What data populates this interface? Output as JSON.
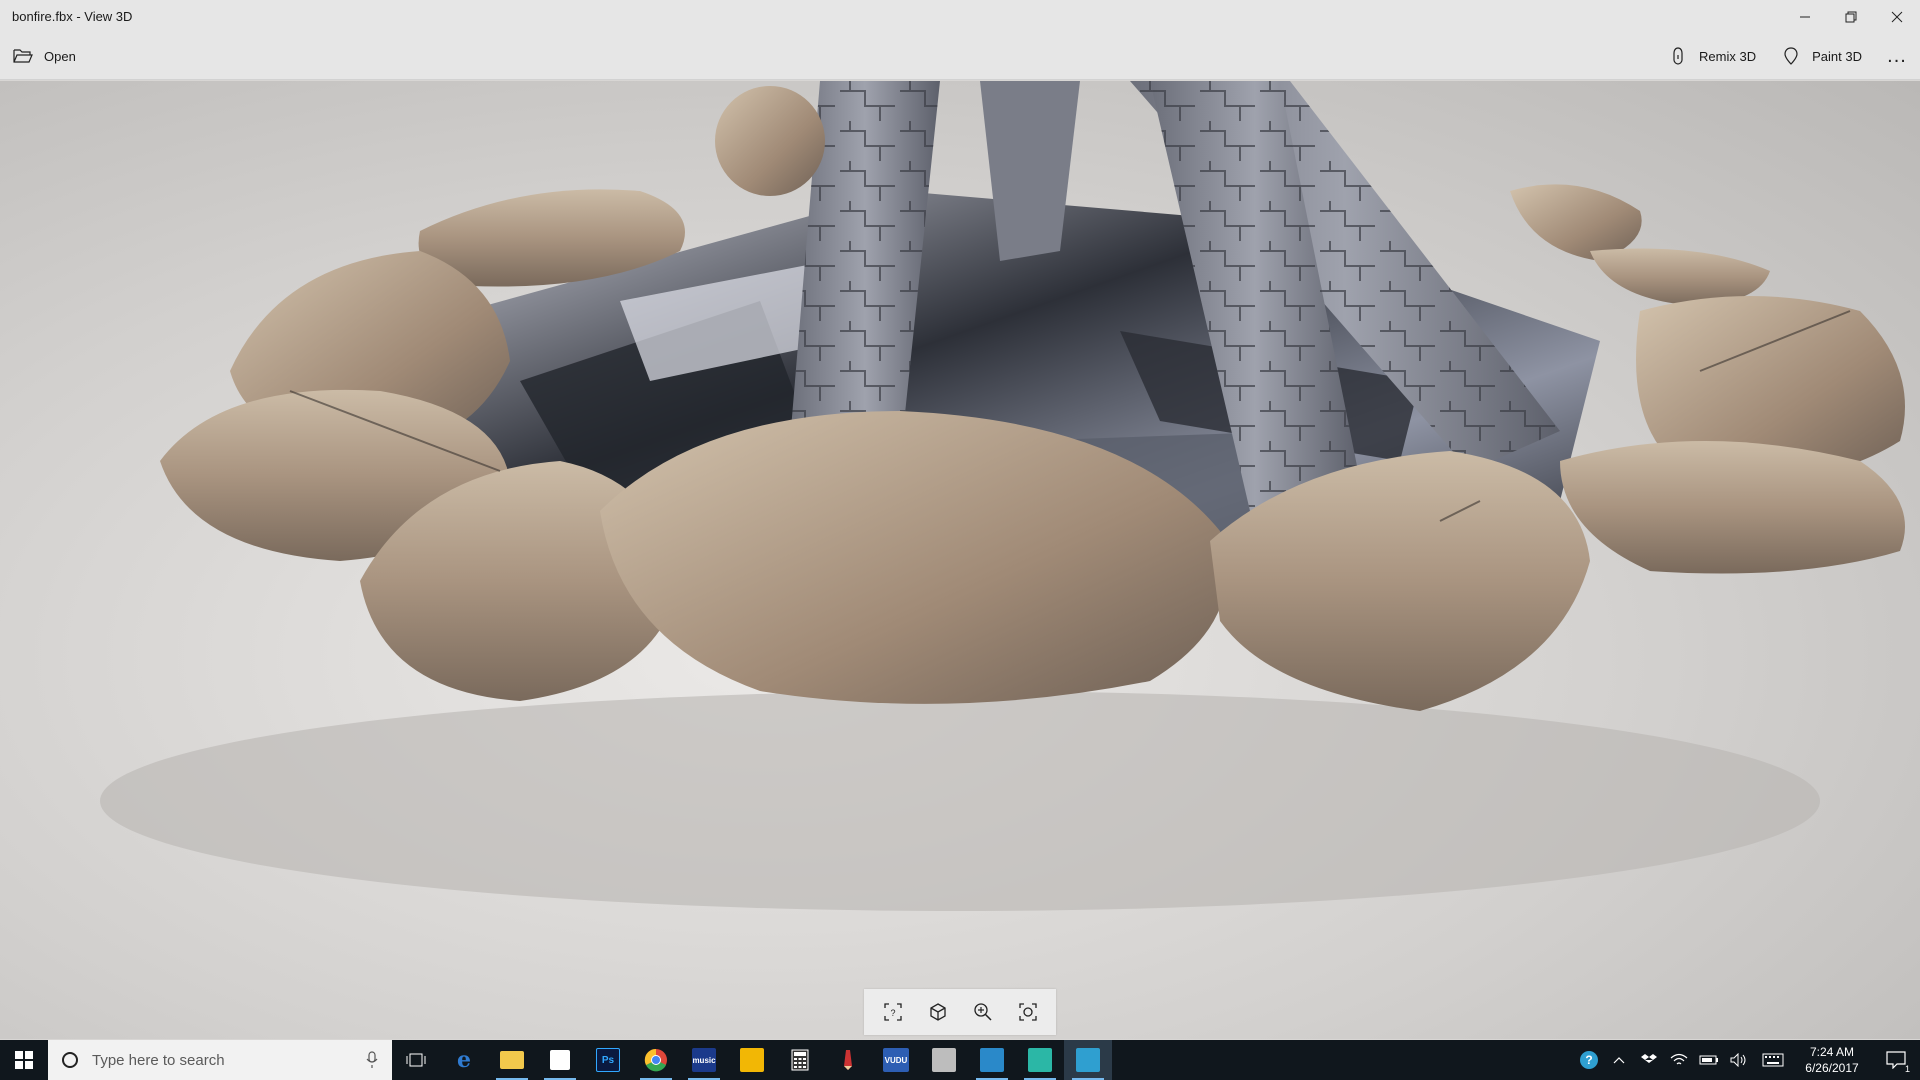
{
  "window": {
    "title": "bonfire.fbx - View 3D"
  },
  "commandbar": {
    "open_label": "Open",
    "remix_label": "Remix 3D",
    "paint_label": "Paint 3D",
    "more_label": "..."
  },
  "viewport": {
    "model": "bonfire",
    "toolbar": [
      "fit-to-view-icon",
      "3d-cube-icon",
      "zoom-icon",
      "capture-icon"
    ]
  },
  "taskbar": {
    "search_placeholder": "Type here to search",
    "apps": [
      {
        "name": "task-view",
        "label": ""
      },
      {
        "name": "edge",
        "label": "e",
        "color": "#2f7bd1"
      },
      {
        "name": "file-explorer",
        "label": "",
        "color": "#f2c94c"
      },
      {
        "name": "store",
        "label": "",
        "color": "#ffffff"
      },
      {
        "name": "photoshop",
        "label": "Ps",
        "color": "#0a1a40"
      },
      {
        "name": "chrome",
        "label": "",
        "color": "#e0473a"
      },
      {
        "name": "amazon-music",
        "label": "music",
        "color": "#1b3a8b"
      },
      {
        "name": "sticky",
        "label": "",
        "color": "#f2b705"
      },
      {
        "name": "calculator",
        "label": "",
        "color": "#222222"
      },
      {
        "name": "paint",
        "label": "",
        "color": "#cc3333"
      },
      {
        "name": "vudu",
        "label": "VUDU",
        "color": "#2d5eb3"
      },
      {
        "name": "notepad",
        "label": "",
        "color": "#bdbdbd"
      },
      {
        "name": "app-blue",
        "label": "",
        "color": "#2a89c9"
      },
      {
        "name": "view3d-taskbar",
        "label": "",
        "color": "#2bb7a6"
      },
      {
        "name": "mixed-reality",
        "label": "",
        "color": "#2f9fd0"
      }
    ],
    "time": "7:24 AM",
    "date": "6/26/2017",
    "notifications": "1"
  }
}
